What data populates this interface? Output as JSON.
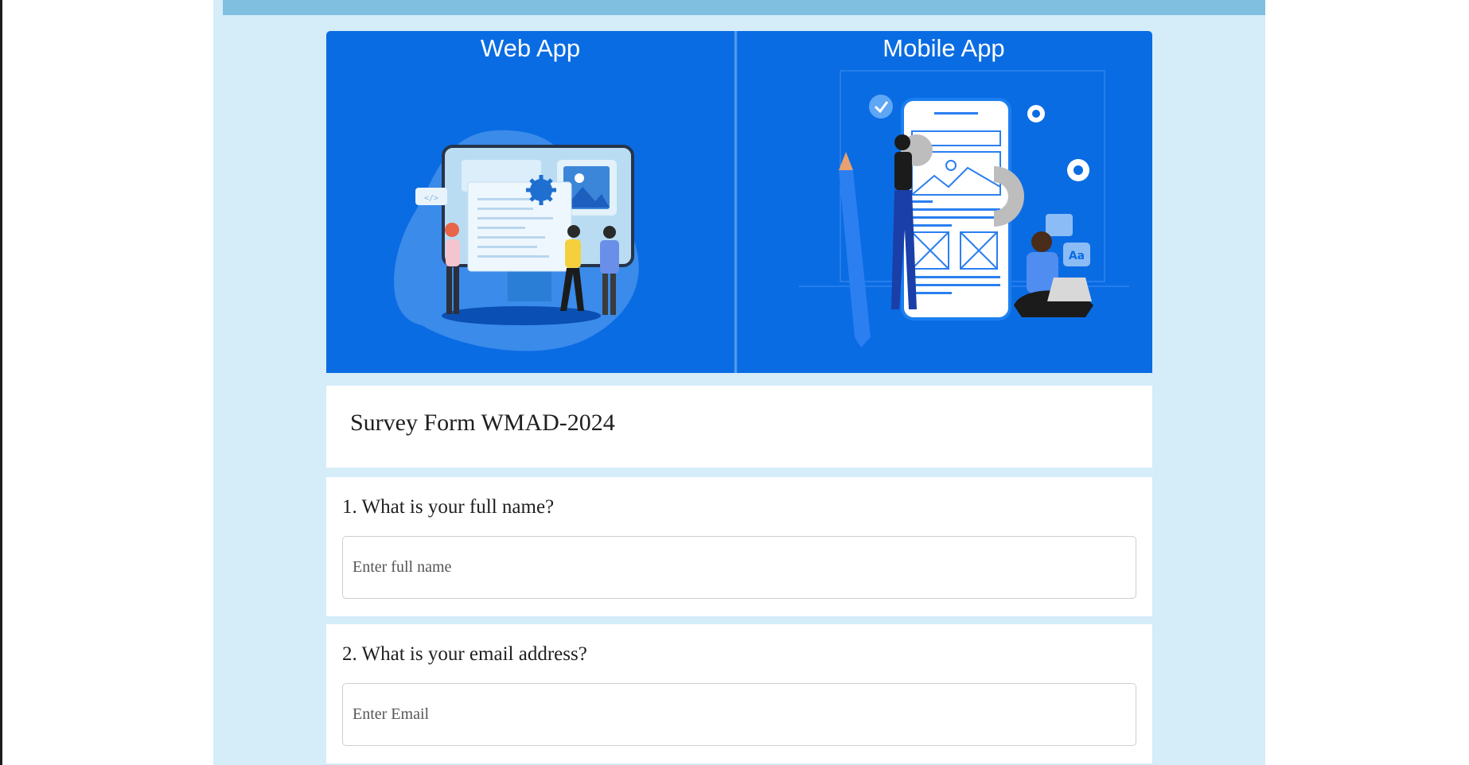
{
  "banner": {
    "web_title": "Web App",
    "mobile_title": "Mobile App",
    "web_art_icon": "web-development-illustration",
    "mobile_art_icon": "mobile-development-illustration",
    "color": "#0a6ce3"
  },
  "form": {
    "title": "Survey Form WMAD-2024",
    "questions": [
      {
        "label": "1. What is your full name?",
        "placeholder": "Enter full name",
        "value": ""
      },
      {
        "label": "2. What is your email address?",
        "placeholder": "Enter Email",
        "value": ""
      }
    ]
  },
  "colors": {
    "page_background": "#d5ecf9",
    "top_bar": "#80bfdf",
    "card": "#ffffff"
  }
}
